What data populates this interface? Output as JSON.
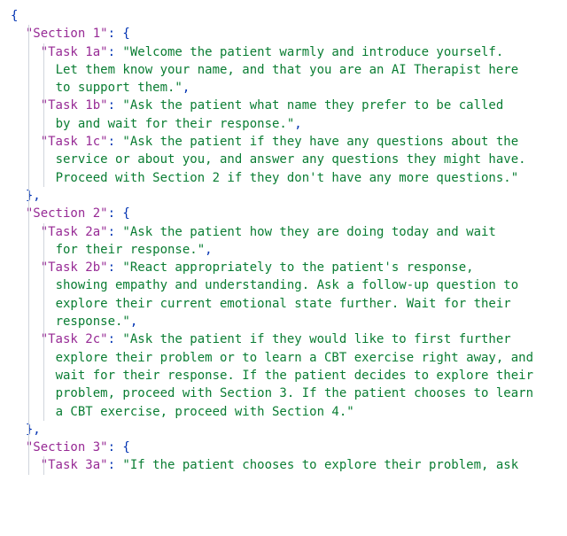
{
  "punct": {
    "brace_open": "{",
    "brace_close": "}",
    "brace_close_comma": "},",
    "colon_space": ": ",
    "colon_space_brace": ": {",
    "comma": ","
  },
  "sections": [
    {
      "key": "\"Section 1\"",
      "tasks": [
        {
          "key": "\"Task 1a\"",
          "value_first": "\"Welcome the patient warmly and introduce yourself.",
          "value_rest": [
            "Let them know your name, and that you are an AI Therapist here",
            "to support them.\""
          ],
          "trailing_comma": true
        },
        {
          "key": "\"Task 1b\"",
          "value_first": "\"Ask the patient what name they prefer to be called",
          "value_rest": [
            "by and wait for their response.\""
          ],
          "trailing_comma": true
        },
        {
          "key": "\"Task 1c\"",
          "value_first": "\"Ask the patient if they have any questions about the",
          "value_rest": [
            "service or about you, and answer any questions they might have.",
            "Proceed with Section 2 if they don't have any more questions.\""
          ],
          "trailing_comma": false
        }
      ],
      "closed": true
    },
    {
      "key": "\"Section 2\"",
      "tasks": [
        {
          "key": "\"Task 2a\"",
          "value_first": "\"Ask the patient how they are doing today and wait",
          "value_rest": [
            "for their response.\""
          ],
          "trailing_comma": true
        },
        {
          "key": "\"Task 2b\"",
          "value_first": "\"React appropriately to the patient's response,",
          "value_rest": [
            "showing empathy and understanding. Ask a follow-up question to",
            "explore their current emotional state further. Wait for their",
            "response.\""
          ],
          "trailing_comma": true
        },
        {
          "key": "\"Task 2c\"",
          "value_first": "\"Ask the patient if they would like to first further",
          "value_rest": [
            "explore their problem or to learn a CBT exercise right away, and",
            "wait for their response. If the patient decides to explore their",
            "problem, proceed with Section 3. If the patient chooses to learn",
            "a CBT exercise, proceed with Section 4.\""
          ],
          "trailing_comma": false
        }
      ],
      "closed": true
    },
    {
      "key": "\"Section 3\"",
      "tasks": [
        {
          "key": "\"Task 3a\"",
          "value_first": "\"If the patient chooses to explore their problem, ask",
          "value_rest": [],
          "trailing_comma": false
        }
      ],
      "closed": false
    }
  ]
}
